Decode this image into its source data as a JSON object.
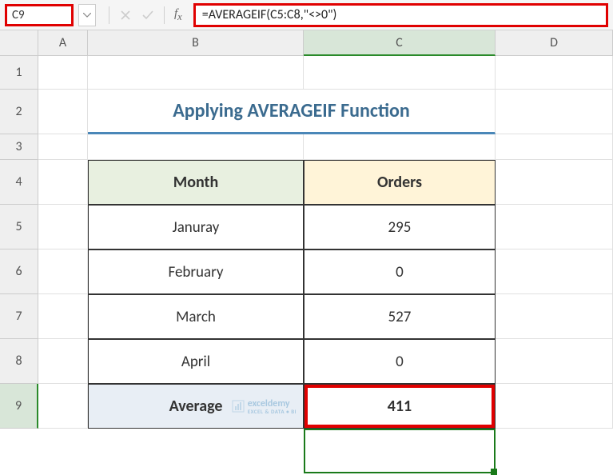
{
  "formula_bar": {
    "name_box": "C9",
    "formula": "=AVERAGEIF(C5:C8,\"<>0\")"
  },
  "columns": {
    "A": "A",
    "B": "B",
    "C": "C",
    "D": "D"
  },
  "rows": {
    "r1": "1",
    "r2": "2",
    "r3": "3",
    "r4": "4",
    "r5": "5",
    "r6": "6",
    "r7": "7",
    "r8": "8",
    "r9": "9"
  },
  "title": "Applying AVERAGEIF Function",
  "headers": {
    "month": "Month",
    "orders": "Orders"
  },
  "data": [
    {
      "month": "Januray",
      "orders": "295"
    },
    {
      "month": "February",
      "orders": "0"
    },
    {
      "month": "March",
      "orders": "527"
    },
    {
      "month": "April",
      "orders": "0"
    }
  ],
  "summary": {
    "label": "Average",
    "value": "411"
  },
  "watermark": {
    "brand": "exceldemy",
    "tagline": "EXCEL & DATA • BI"
  },
  "chart_data": {
    "type": "table",
    "title": "Applying AVERAGEIF Function",
    "columns": [
      "Month",
      "Orders"
    ],
    "rows": [
      [
        "Januray",
        295
      ],
      [
        "February",
        0
      ],
      [
        "March",
        527
      ],
      [
        "April",
        0
      ]
    ],
    "summary": {
      "label": "Average",
      "value": 411,
      "formula": "=AVERAGEIF(C5:C8,\"<>0\")"
    }
  }
}
